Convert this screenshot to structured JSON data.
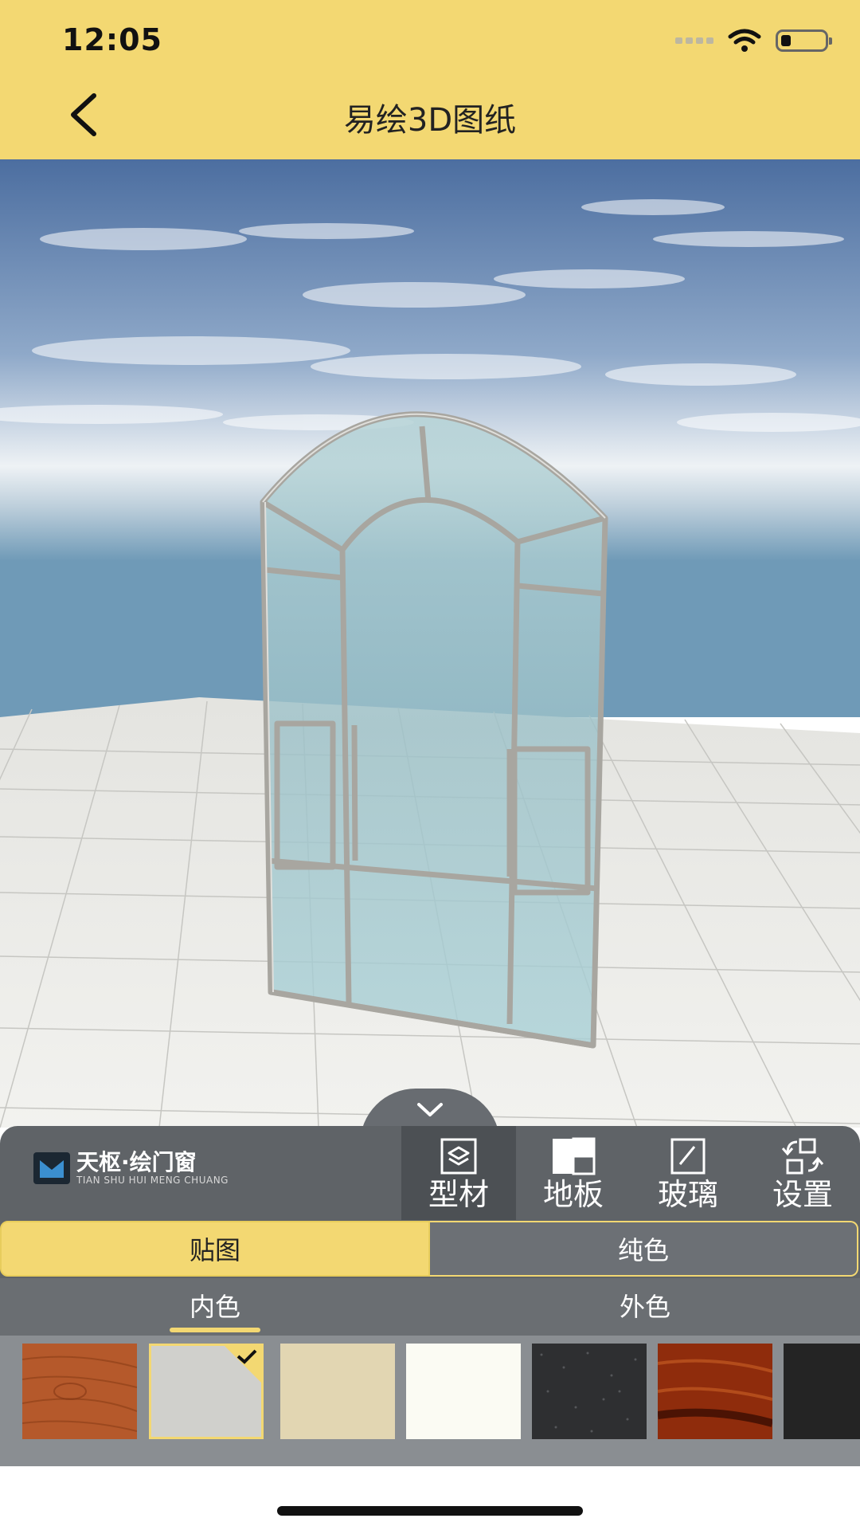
{
  "status_bar": {
    "time": "12:05"
  },
  "header": {
    "title": "易绘3D图纸",
    "back_icon": "chevron-left-icon"
  },
  "brand": {
    "name": "天枢·绘门窗",
    "subtitle": "TIAN SHU HUI MENG CHUANG"
  },
  "toolbar": {
    "items": [
      {
        "label": "型材",
        "icon": "profile-layers-icon",
        "active": true
      },
      {
        "label": "地板",
        "icon": "floor-tiles-icon",
        "active": false
      },
      {
        "label": "玻璃",
        "icon": "glass-pane-icon",
        "active": false
      },
      {
        "label": "设置",
        "icon": "settings-rotate-icon",
        "active": false
      }
    ]
  },
  "segment": {
    "left_label": "贴图",
    "right_label": "纯色",
    "selected": "贴图"
  },
  "subtabs": {
    "inner_label": "内色",
    "outer_label": "外色",
    "selected": "内色"
  },
  "swatches": {
    "items": [
      {
        "name": "wood-light",
        "color": "#b5592b",
        "selected": false
      },
      {
        "name": "light-gray",
        "color": "#d0d0cc",
        "selected": true
      },
      {
        "name": "beige",
        "color": "#e2d6b2",
        "selected": false
      },
      {
        "name": "ivory",
        "color": "#fbfbf3",
        "selected": false
      },
      {
        "name": "granite-dark",
        "color": "#2e2f31",
        "selected": false
      },
      {
        "name": "wood-dark",
        "color": "#8f2c0c",
        "selected": false
      },
      {
        "name": "black",
        "color": "#242424",
        "selected": false
      }
    ]
  },
  "colors": {
    "accent": "#f3d872",
    "panel": "#5f6367"
  }
}
